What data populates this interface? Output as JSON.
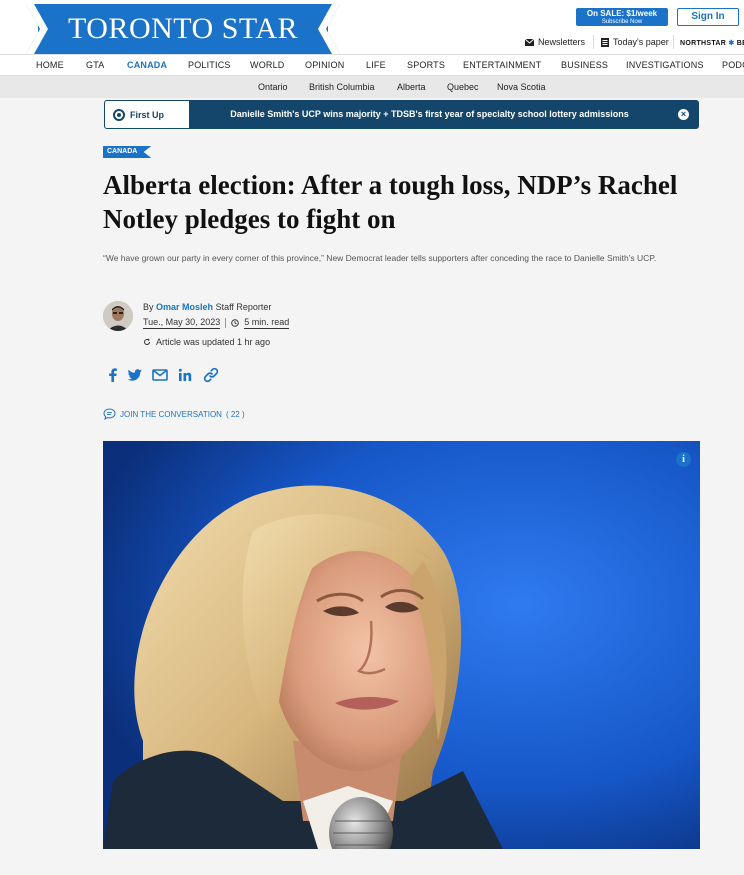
{
  "header": {
    "logo_text": "TORONTO STAR",
    "sale": {
      "line1": "On SALE: $1/week",
      "line2": "Subscribe Now"
    },
    "signin_label": "Sign In",
    "newsletters_label": "Newsletters",
    "todays_paper_label": "Today's paper",
    "northstar_label": "NORTHSTAR",
    "northstar_suffix": "BE",
    "brand_color": "#1a73c8"
  },
  "nav": {
    "items": [
      "HOME",
      "GTA",
      "CANADA",
      "POLITICS",
      "WORLD",
      "OPINION",
      "LIFE",
      "SPORTS",
      "ENTERTAINMENT",
      "BUSINESS",
      "INVESTIGATIONS",
      "PODC"
    ],
    "active": "CANADA"
  },
  "subnav": {
    "items": [
      "Ontario",
      "British Columbia",
      "Alberta",
      "Quebec",
      "Nova Scotia"
    ]
  },
  "first_up": {
    "label": "First Up",
    "text": "Danielle Smith's UCP wins majority + TDSB's first year of specialty school lottery admissions",
    "close_symbol": "×"
  },
  "article": {
    "section": "CANADA",
    "headline": "Alberta election: After a tough loss, NDP’s Rachel Notley pledges to fight on",
    "dek": "“We have grown our party in every corner of this province,” New Democrat leader tells supporters after conceding the race to Danielle Smith’s UCP.",
    "byline_prefix": "By",
    "author": "Omar Mosleh",
    "author_role": "Staff Reporter",
    "date": "Tue., May 30, 2023",
    "read_time": "5 min. read",
    "updated": "Article was updated 1 hr ago",
    "conversation_label": "JOIN THE CONVERSATION",
    "conversation_count": "( 22 )",
    "share_icons": [
      "facebook-icon",
      "twitter-icon",
      "email-icon",
      "linkedin-icon",
      "link-icon"
    ],
    "photo_info_symbol": "i"
  }
}
